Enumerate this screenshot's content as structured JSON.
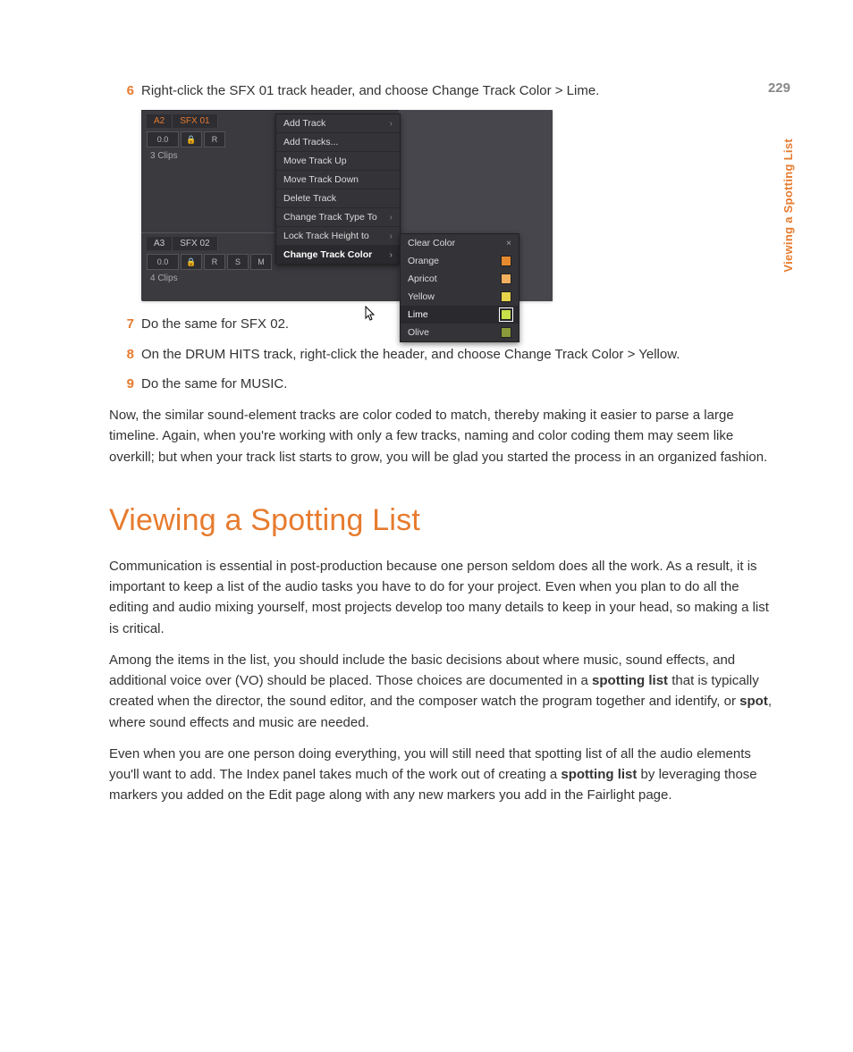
{
  "page_number": "229",
  "side_label": "Viewing a Spotting List",
  "steps": [
    {
      "n": "6",
      "t": "Right-click the SFX 01 track header, and choose Change Track Color > Lime."
    },
    {
      "n": "7",
      "t": "Do the same for SFX 02."
    },
    {
      "n": "8",
      "t": "On the DRUM HITS track, right-click the header, and choose Change Track Color > Yellow."
    },
    {
      "n": "9",
      "t": "Do the same for MUSIC."
    }
  ],
  "screenshot": {
    "track1": {
      "id": "A2",
      "name": "SFX 01",
      "level": "0.0",
      "clips": "3 Clips",
      "buttons": [
        "R"
      ]
    },
    "track2": {
      "id": "A3",
      "name": "SFX 02",
      "level": "0.0",
      "clips": "4 Clips",
      "buttons": [
        "R",
        "S",
        "M"
      ]
    },
    "menu": [
      {
        "label": "Add Track",
        "sub": true
      },
      {
        "label": "Add Tracks...",
        "sub": false
      },
      {
        "label": "Move Track Up",
        "sub": false
      },
      {
        "label": "Move Track Down",
        "sub": false
      },
      {
        "label": "Delete Track",
        "sub": false
      },
      {
        "label": "Change Track Type To",
        "sub": true
      },
      {
        "label": "Lock Track Height to",
        "sub": true
      },
      {
        "label": "Change Track Color",
        "sub": true,
        "hl": true
      }
    ],
    "submenu": [
      {
        "label": "Clear Color",
        "swatch": null,
        "close": true
      },
      {
        "label": "Orange",
        "swatch": "#e58a2e"
      },
      {
        "label": "Apricot",
        "swatch": "#f0b060"
      },
      {
        "label": "Yellow",
        "swatch": "#e6d34a"
      },
      {
        "label": "Lime",
        "swatch": "#c8e04a",
        "hl": true,
        "outline": true
      },
      {
        "label": "Olive",
        "swatch": "#8a9a3a"
      }
    ]
  },
  "para_after_steps": "Now, the similar sound-element tracks are color coded to match, thereby making it easier to parse a large timeline. Again, when you're working with only a few tracks, naming and color coding them may seem like overkill; but when your track list starts to grow, you will be glad you started the process in an organized fashion.",
  "heading": "Viewing a Spotting List",
  "body_paras": [
    "Communication is essential in post-production because one person seldom does all the work. As a result, it is important to keep a list of the audio tasks you have to do for your project. Even when you plan to do all the editing and audio mixing yourself, most projects develop too many details to keep in your head, so making a list is critical.",
    "Among the items in the list, you should include the basic decisions about where music, sound effects, and additional voice over (VO) should be placed. Those choices are documented in a <strong>spotting list</strong> that is typically created when the director, the sound editor, and the composer watch the program together and identify, or <strong>spot</strong>, where sound effects and music are needed.",
    "Even when you are one person doing everything, you will still need that spotting list of all the audio elements you'll want to add. The Index panel takes much of the work out of creating a <strong>spotting list</strong> by leveraging those markers you added on the Edit page along with any new markers you add in the Fairlight page."
  ]
}
